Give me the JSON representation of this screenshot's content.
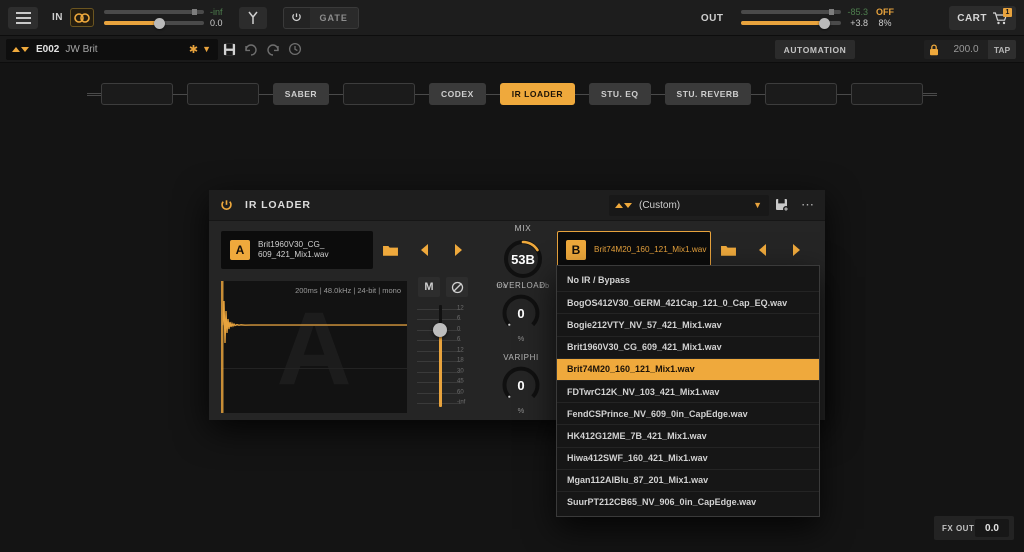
{
  "topbar": {
    "menu_icon": "hamburger-icon",
    "in_label": "IN",
    "link_icon": "stereo-link-icon",
    "in_value_top": "-inf",
    "in_value_bottom": "0.0",
    "tuner_icon": "tuner-icon",
    "gate_power_icon": "power-icon",
    "gate_label": "GATE",
    "out_label": "OUT",
    "out_value_top": "-85.3",
    "out_value_bottom": "+3.8",
    "out_state": "OFF",
    "out_percent": "8%",
    "cart_label": "CART",
    "cart_badge": "1",
    "cart_icon": "shopping-cart-icon"
  },
  "presetbar": {
    "updown_icon": "up-down-arrows-icon",
    "preset_id": "E002",
    "preset_name": "JW Brit",
    "star_icon": "star-icon",
    "chevron_icon": "chevron-down-icon",
    "save_icon": "save-icon",
    "undo_icon": "undo-icon",
    "redo_icon": "redo-icon",
    "history_icon": "history-icon",
    "automation_label": "AUTOMATION",
    "lock_icon": "lock-icon",
    "tempo": "200.0",
    "tap_label": "TAP"
  },
  "chain": {
    "slots": [
      {
        "label": "",
        "state": "empty"
      },
      {
        "label": "",
        "state": "empty"
      },
      {
        "label": "SABER",
        "state": "filled"
      },
      {
        "label": "",
        "state": "empty"
      },
      {
        "label": "CODEX",
        "state": "filled"
      },
      {
        "label": "IR LOADER",
        "state": "active"
      },
      {
        "label": "STU. EQ",
        "state": "filled"
      },
      {
        "label": "STU. REVERB",
        "state": "filled"
      },
      {
        "label": "",
        "state": "empty"
      },
      {
        "label": "",
        "state": "empty"
      }
    ]
  },
  "panel": {
    "power_icon": "power-icon",
    "title": "IR LOADER",
    "preset_updown_icon": "up-down-arrows-icon",
    "preset_name": "(Custom)",
    "preset_chevron_icon": "chevron-down-icon",
    "save_as_icon": "save-as-icon",
    "more_icon": "more-options-icon",
    "slot_a": {
      "tag": "A",
      "name_line1": "Brit1960V30_CG_",
      "name_line2": "609_421_Mix1.wav",
      "folder_icon": "folder-icon",
      "prev_icon": "previous-arrow-icon",
      "next_icon": "next-arrow-icon"
    },
    "slot_b": {
      "tag": "B",
      "name_line1": "Brit74M20_160_121_Mix1.wav",
      "name_line2": "",
      "folder_icon": "folder-icon",
      "prev_icon": "previous-arrow-icon",
      "next_icon": "next-arrow-icon"
    },
    "mix": {
      "label": "MIX",
      "value": "53B",
      "left_label": "ir a",
      "right_label": "ir b",
      "percent": 53
    },
    "waveform": {
      "info": "200ms | 48.0kHz | 24-bit | mono",
      "watermark": "A"
    },
    "fader": {
      "mute_label": "M",
      "phase_icon": "phase-invert-icon",
      "ticks": [
        "12",
        "6",
        "0",
        "6",
        "12",
        "18",
        "30",
        "45",
        "60",
        "-inf"
      ]
    },
    "overload": {
      "label": "OVERLOAD",
      "value": "0",
      "unit": "%"
    },
    "variphi": {
      "label": "VARIPHI",
      "value": "0",
      "unit": "%"
    }
  },
  "dropdown": {
    "items": [
      {
        "label": "No IR / Bypass",
        "selected": false
      },
      {
        "label": "BogOS412V30_GERM_421Cap_121_0_Cap_EQ.wav",
        "selected": false
      },
      {
        "label": "Bogie212VTY_NV_57_421_Mix1.wav",
        "selected": false
      },
      {
        "label": "Brit1960V30_CG_609_421_Mix1.wav",
        "selected": false
      },
      {
        "label": "Brit74M20_160_121_Mix1.wav",
        "selected": true
      },
      {
        "label": "FDTwrC12K_NV_103_421_Mix1.wav",
        "selected": false
      },
      {
        "label": "FendCSPrince_NV_609_0in_CapEdge.wav",
        "selected": false
      },
      {
        "label": "HK412G12ME_7B_421_Mix1.wav",
        "selected": false
      },
      {
        "label": "Hiwa412SWF_160_421_Mix1.wav",
        "selected": false
      },
      {
        "label": "Mgan112AlBlu_87_201_Mix1.wav",
        "selected": false
      },
      {
        "label": "SuurPT212CB65_NV_906_0in_CapEdge.wav",
        "selected": false
      }
    ]
  },
  "fxout": {
    "label": "FX OUT",
    "value": "0.0"
  },
  "colors": {
    "accent": "#efa93c",
    "background": "#141414",
    "panel": "#252525"
  }
}
